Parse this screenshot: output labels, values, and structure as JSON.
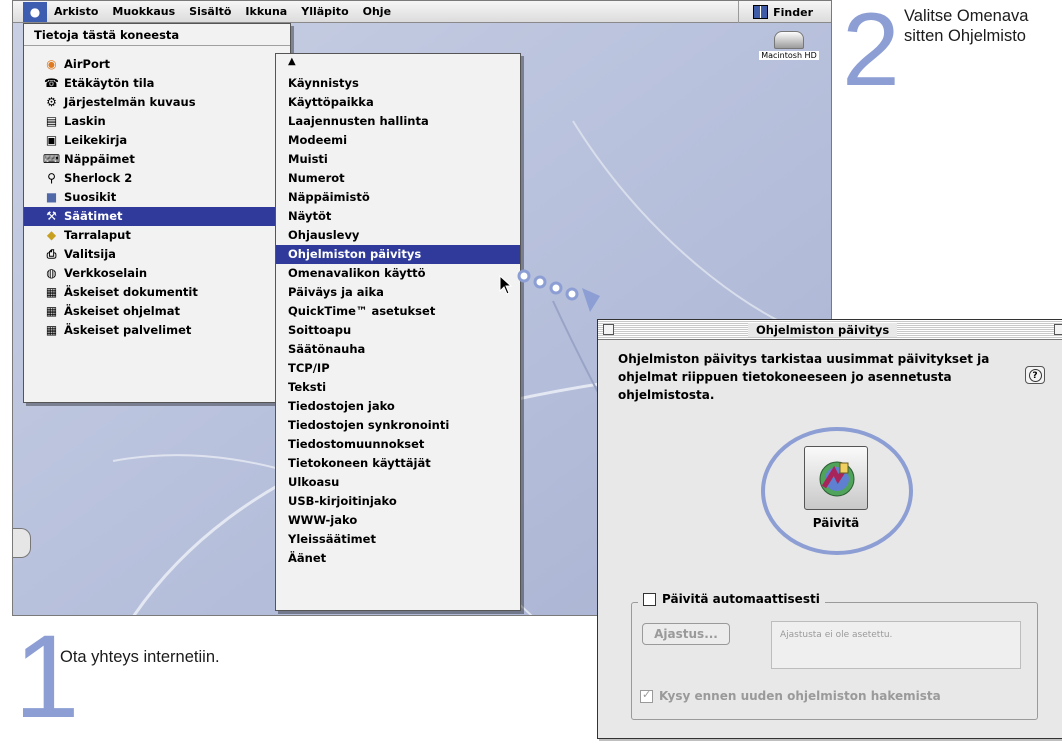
{
  "menubar": {
    "items": [
      "Arkisto",
      "Muokkaus",
      "Sisältö",
      "Ikkuna",
      "Ylläpito",
      "Ohje"
    ],
    "app_name": "Finder"
  },
  "apple_menu": {
    "about": "Tietoja tästä koneesta",
    "items": [
      {
        "label": "AirPort",
        "icon": "airport-icon"
      },
      {
        "label": "Etäkäytön tila",
        "icon": "remote-access-icon"
      },
      {
        "label": "Järjestelmän kuvaus",
        "icon": "system-profiler-icon"
      },
      {
        "label": "Laskin",
        "icon": "calculator-icon"
      },
      {
        "label": "Leikekirja",
        "icon": "scrapbook-icon"
      },
      {
        "label": "Näppäimet",
        "icon": "key-caps-icon"
      },
      {
        "label": "Sherlock 2",
        "icon": "sherlock-icon"
      },
      {
        "label": "Suosikit",
        "icon": "favorites-icon",
        "submenu": true
      },
      {
        "label": "Säätimet",
        "icon": "control-panels-icon",
        "submenu": true,
        "selected": true
      },
      {
        "label": "Tarralaput",
        "icon": "stickies-icon"
      },
      {
        "label": "Valitsija",
        "icon": "chooser-icon"
      },
      {
        "label": "Verkkoselain",
        "icon": "browser-icon"
      },
      {
        "label": "Äskeiset dokumentit",
        "icon": "recent-documents-icon",
        "submenu": true
      },
      {
        "label": "Äskeiset ohjelmat",
        "icon": "recent-applications-icon",
        "submenu": true
      },
      {
        "label": "Äskeiset palvelimet",
        "icon": "recent-servers-icon",
        "submenu": true
      }
    ]
  },
  "control_panels": {
    "items": [
      "Käynnistys",
      "Käyttöpaikka",
      "Laajennusten hallinta",
      "Modeemi",
      "Muisti",
      "Numerot",
      "Näppäimistö",
      "Näytöt",
      "Ohjauslevy",
      "Ohjelmiston päivitys",
      "Omenavalikon käyttö",
      "Päiväys ja aika",
      "QuickTime™ asetukset",
      "Soittoapu",
      "Säätönauha",
      "TCP/IP",
      "Teksti",
      "Tiedostojen jako",
      "Tiedostojen synkronointi",
      "Tiedostomuunnokset",
      "Tietokoneen käyttäjät",
      "Ulkoasu",
      "USB-kirjoitinjako",
      "WWW-jako",
      "Yleissäätimet",
      "Äänet"
    ],
    "selected_index": 9
  },
  "desktop": {
    "disk_label": "Macintosh HD"
  },
  "steps": {
    "step1_number": "1",
    "step1_text": "Ota yhteys internetiin.",
    "step2_number": "2",
    "step2_text_line1": "Valitse Omenava",
    "step2_text_line2": "sitten Ohjelmisto"
  },
  "software_update": {
    "title": "Ohjelmiston päivitys",
    "description": "Ohjelmiston päivitys tarkistaa uusimmat päivitykset ja ohjelmat riippuen tietokoneeseen jo asennetusta ohjelmistosta.",
    "help_glyph": "?",
    "update_button_label": "Päivitä",
    "auto_update_label": "Päivitä automaattisesti",
    "auto_update_checked": false,
    "schedule_button": "Ajastus...",
    "schedule_status": "Ajastusta ei ole asetettu.",
    "ask_before_label": "Kysy ennen uuden ohjelmiston hakemista",
    "ask_before_checked": true
  },
  "colors": {
    "selection": "#2f3a9a",
    "accent_blue": "#8c9ed4"
  }
}
